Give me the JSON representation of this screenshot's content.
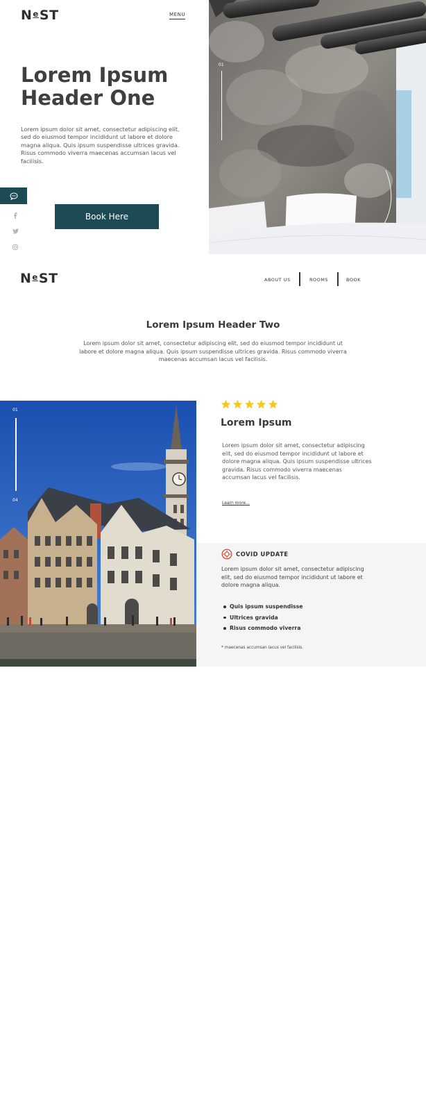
{
  "brand": {
    "logo": "NEST",
    "logo_prefix": "N",
    "logo_o": "e",
    "logo_suffix": "ST",
    "accent": "#1c4a55",
    "star_color": "#f4c81f",
    "covid_color": "#d93a2b"
  },
  "hero": {
    "menu_label": "MENU",
    "title": "Lorem Ipsum Header One",
    "text": "Lorem ipsum dolor sit amet, consectetur adipiscing elit, sed do eiusmod tempor incididunt ut labore et dolore magna aliqua. Quis ipsum suspendisse ultrices gravida. Risus commodo viverra maecenas accumsan lacus vel facilisis.",
    "button_label": "Book Here",
    "chat_icon": "chat-bubble-icon",
    "social_icons": [
      "facebook-icon",
      "twitter-icon",
      "instagram-icon"
    ],
    "photo_counter_start": "01"
  },
  "header2": {
    "nav": [
      "ABOUT US",
      "ROOMS",
      "BOOK"
    ]
  },
  "section": {
    "title": "Lorem Ipsum Header Two",
    "text": "Lorem ipsum dolor sit amet, consectetur adipiscing elit, sed do eiusmod tempor incididunt ut labore et dolore magna aliqua. Quis ipsum suspendisse ultrices gravida. Risus commodo viverra maecenas accumsan lacus vel facilisis."
  },
  "feature": {
    "counter_start": "01",
    "counter_end": "04",
    "rating": 5,
    "title": "Lorem Ipsum",
    "text": "Lorem ipsum dolor sit amet, consectetur adipiscing elit, sed do eiusmod tempor incididunt ut labore et dolore magna aliqua. Quis ipsum suspendisse ultrices gravida. Risus commodo viverra maecenas accumsan lacus vel facilisis.",
    "learn_more": "Learn more..."
  },
  "covid": {
    "title": "COVID UPDATE",
    "text": "Lorem ipsum dolor sit amet, consectetur adipiscing elit, sed do eiusmod tempor incididunt ut labore et dolore magna aliqua.",
    "items": [
      "Quis ipsum suspendisse",
      "Ultrices gravida",
      "Risus commodo viverra"
    ],
    "note": "* maecenas accumsan lacus vel facilisis."
  }
}
